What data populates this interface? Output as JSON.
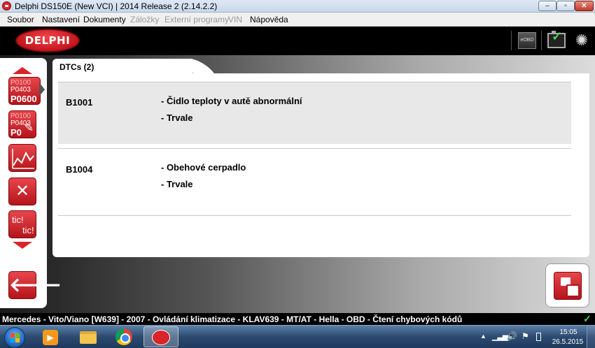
{
  "window": {
    "title": "Delphi DS150E (New VCI) | 2014 Release 2 (2.14.2.2)",
    "minimize_glyph": "–",
    "maximize_glyph": "▫",
    "close_glyph": "✕"
  },
  "menu": {
    "items": [
      {
        "label": "Soubor",
        "enabled": true
      },
      {
        "label": "Nastavení",
        "enabled": true
      },
      {
        "label": "Dokumenty",
        "enabled": true
      },
      {
        "label": "Záložky",
        "enabled": false
      },
      {
        "label": "Externí programy",
        "enabled": false
      },
      {
        "label": "VIN",
        "enabled": false
      },
      {
        "label": "Nápověda",
        "enabled": true
      }
    ]
  },
  "header": {
    "logo_text": "DELPHI",
    "eobd_label": "eOBD",
    "battery_icon": "battery-charging-icon",
    "status_icon": "spinner-icon",
    "spinner_glyph": "✺"
  },
  "sidebar": {
    "tiles": [
      {
        "name": "fault-codes",
        "lines": [
          "P0100",
          "P0403",
          "P0600"
        ],
        "active": true
      },
      {
        "name": "erase-codes",
        "lines": [
          "P0100",
          "P0403",
          "P0"
        ],
        "active": false
      },
      {
        "name": "live-data",
        "icon": "graph-icon",
        "active": false
      },
      {
        "name": "tests",
        "icon": "tools-icon",
        "active": false
      },
      {
        "name": "tic-tic",
        "lines": [
          "tic!",
          "tic!"
        ],
        "active": false
      }
    ],
    "back_icon": "back-arrow-icon",
    "back_glyph": "🡐"
  },
  "tab": {
    "label": "DTCs (2)"
  },
  "dtcs": [
    {
      "code": "B1001",
      "description": "- Čidlo teploty v autě abnormální",
      "status": "- Trvale"
    },
    {
      "code": "B1004",
      "description": "- Obehové cerpadlo",
      "status": "- Trvale"
    }
  ],
  "print_button": {
    "icon": "print-report-icon"
  },
  "status_bar": {
    "text": "Mercedes - Vito/Viano [W639] - 2007 - Ovládání klimatizace - KLAV639 - MT/AT - Hella - OBD - Čtení chybových kódů",
    "check_glyph": "✓"
  },
  "taskbar": {
    "apps": [
      "media-player-icon",
      "file-explorer-icon",
      "chrome-icon",
      "delphi-app-icon"
    ],
    "media_glyph": "▶",
    "tray_up_glyph": "▲",
    "tray_signal_glyph": "▁▃▅",
    "tray_volume_glyph": "🔊",
    "tray_flag_glyph": "⚑",
    "time": "15:05",
    "date": "26.5.2015"
  }
}
